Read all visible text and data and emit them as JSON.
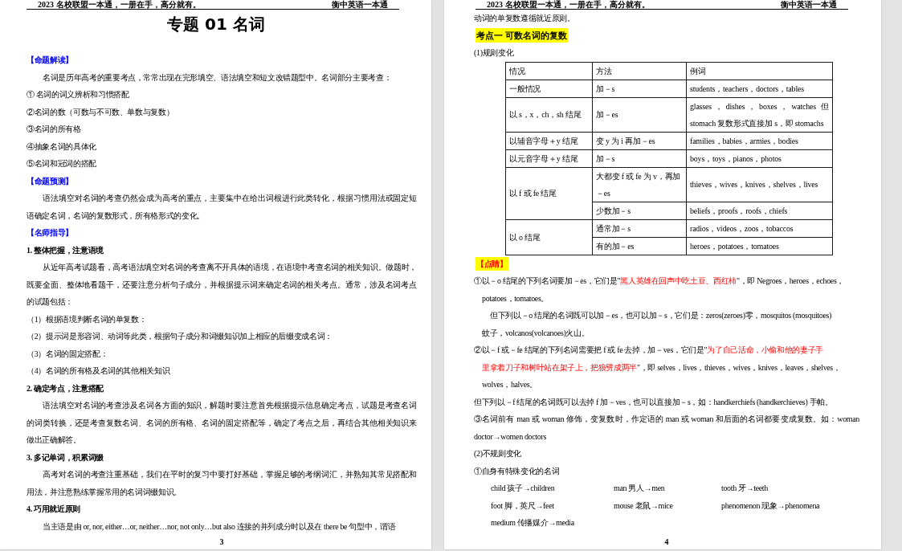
{
  "pages": [
    {
      "header": {
        "left": "2023 名校联盟一本通，一册在手，高分就有。",
        "right": "衡中英语一本通"
      },
      "blocks": [
        {
          "kind": "title",
          "lines": [
            "专题 01 名词"
          ]
        },
        {
          "kind": "section",
          "lines": [
            "【命题解读】"
          ]
        },
        {
          "kind": "paragraph",
          "lines": [
            "名词是历年高考的重要考点，常常出现在完形填空、语法填空和短文改错题型中。名词部分主要考查："
          ]
        },
        {
          "kind": "item",
          "lines": [
            "① 名词的词义辨析和习惯搭配"
          ]
        },
        {
          "kind": "item",
          "lines": [
            "②名词的数（可数与不可数、单数与复数）"
          ]
        },
        {
          "kind": "item",
          "lines": [
            "③名词的所有格"
          ]
        },
        {
          "kind": "item",
          "lines": [
            "④抽象名词的具体化"
          ]
        },
        {
          "kind": "item",
          "lines": [
            "⑤名词和冠词的搭配"
          ]
        },
        {
          "kind": "section",
          "lines": [
            "【命题预测】"
          ]
        },
        {
          "kind": "paragraph",
          "lines": [
            "语法填空对名词的考查仍然会成为高考的重点，主要集中在给出词根进行此类转化，根据习惯用法或固定短",
            "语确定名词，名词的复数形式，所有格形式的变化。"
          ]
        },
        {
          "kind": "section",
          "lines": [
            "【名师指导】"
          ]
        },
        {
          "kind": "heading",
          "lines": [
            "1. 整体把握，注意语境"
          ]
        },
        {
          "kind": "paragraph",
          "lines": [
            "从近年高考试题看，高考语法填空对名词的考查离不开具体的语境，在语境中考查名词的相关知识。做题时，",
            "既要全面、整体地看题干，还要注意分析句子成分，并根据提示词来确定名词的相关考点。通常，涉及名词考点",
            "的试题包括："
          ]
        },
        {
          "kind": "item",
          "lines": [
            "（1）根据语境判断名词的单复数："
          ]
        },
        {
          "kind": "item",
          "lines": [
            "（2）提示词是形容词、动词等此类，根据句子成分和词缀知识加上相应的后缀变成名词："
          ]
        },
        {
          "kind": "item",
          "lines": [
            "（3）名词的固定搭配："
          ]
        },
        {
          "kind": "item",
          "lines": [
            "（4）名词的所有格及名词的其他相关知识"
          ]
        },
        {
          "kind": "heading",
          "lines": [
            "2. 确定考点，注意搭配"
          ]
        },
        {
          "kind": "paragraph",
          "lines": [
            "语法填空对名词的考查涉及名词各方面的知识，解题时要注意首先根据提示信息确定考点，试题是考查名词",
            "的词类转换，还是考查复数名词、名词的所有格、名词的固定搭配等，确定了考点之后，再结合其他相关知识来",
            "做出正确解答。"
          ]
        },
        {
          "kind": "heading",
          "lines": [
            "3. 多记单词，积累词缀"
          ]
        },
        {
          "kind": "paragraph",
          "lines": [
            "高考对名词的考查注重基础，我们在平时的复习中要打好基础，掌握足够的考纲词汇，并熟知其常见搭配和",
            "用法，并注意熟练掌握常用的名词词缀知识。"
          ]
        },
        {
          "kind": "heading",
          "lines": [
            "4. 巧用就近原则"
          ]
        },
        {
          "kind": "paragraph",
          "lines": [
            "当主语是由 or, nor, either…or, neither…nor, not only…but also 连接的并列成分时以及在 there be 句型中，谓语"
          ]
        }
      ],
      "page_number": "3"
    },
    {
      "header": {
        "left": "2023 名校联盟一本通，一册在手，高分就有。",
        "right": "衡中英语一本通"
      },
      "blocks": [
        {
          "kind": "text",
          "lines": [
            "动词的单复数遵循就近原则。"
          ]
        },
        {
          "kind": "highlight",
          "lines": [
            "考点一 可数名词的复数"
          ]
        },
        {
          "kind": "text",
          "lines": [
            "(1)规则变化"
          ]
        },
        {
          "kind": "table",
          "columns": [
            "情况",
            "方法",
            "例词"
          ],
          "rows": [
            {
              "case": "一般情况",
              "forms": [
                {
                  "method": "加－s",
                  "examples": "students，teachers，doctors，tables"
                }
              ]
            },
            {
              "case": "以 s，x，ch，sh 结尾",
              "forms": [
                {
                  "method": "加－es",
                  "examples": "glasses，dishes，boxes，watches 但 stomach 复数形式直接加 s，即 stomachs"
                }
              ]
            },
            {
              "case": "以辅音字母＋y 结尾",
              "forms": [
                {
                  "method": "变 y 为 i 再加－es",
                  "examples": "families，babies，armies，bodies"
                }
              ]
            },
            {
              "case": "以元音字母＋y 结尾",
              "forms": [
                {
                  "method": "加－s",
                  "examples": "boys，toys，pianos，photos"
                }
              ]
            },
            {
              "case": "以 f 或 fe 结尾",
              "forms": [
                {
                  "method": "大都变 f 或 fe 为 v，再加－es",
                  "examples": "thieves，wives，knives，shelves，lives"
                },
                {
                  "method": "少数加－s",
                  "examples": "beliefs，proofs，roofs，chiefs"
                }
              ]
            },
            {
              "case": "以 o 结尾",
              "forms": [
                {
                  "method": "通常加－s",
                  "examples": "radios，videos，zoos，tobaccos"
                },
                {
                  "method": "有的加－es",
                  "examples": "heroes，potatoes，tomatoes"
                }
              ]
            }
          ]
        },
        {
          "kind": "tag",
          "lines": [
            "【点睛】"
          ]
        },
        {
          "kind": "hanging",
          "lines": [
            [
              {
                "text": "①以－o 结尾的下列名词要加－es，它们是\"",
                "emphasized": false
              },
              {
                "text": "黑人英雄在回声中吃土豆、西红柿",
                "emphasized": true
              },
              {
                "text": "\"，即 Negroes，heroes，echoes，",
                "emphasized": false
              }
            ],
            "potatoes，tomatoes。"
          ]
        },
        {
          "kind": "inset",
          "lines": [
            "但下列以－o 结尾的名词既可以加－es，也可以加－s，它们是：zeros(zeroes)零，mosquitos (mosquitoes)",
            "蚊子，volcanos(volcanoes)火山。"
          ]
        },
        {
          "kind": "hanging",
          "lines": [
            [
              {
                "text": "②以－f 或－fe 结尾的下列名词需要把 f 或 fe 去掉，加－ves，它们是\"",
                "emphasized": false
              },
              {
                "text": "为了自己活命，小偷和他的妻子手",
                "emphasized": true
              }
            ],
            [
              {
                "text": "里拿着刀子和树叶站在架子上，把狼劈成两半",
                "emphasized": true
              },
              {
                "text": "\"，即 selves，lives，thieves，wives，knives，leaves，shelves，",
                "emphasized": false
              }
            ],
            "wolves，halves。"
          ]
        },
        {
          "kind": "text",
          "lines": [
            "但下列以－f 结尾的名词既可以去掉 f 加－ves，也可以直接加－s，如：handkerchiefs (handkerchieves) 手帕。"
          ]
        },
        {
          "kind": "text",
          "lines": [
            "③名词前有 man 或 woman 修饰，变复数时，作定语的 man 或 woman 和后面的名词都要变成复数。如：woman",
            "doctor→women doctors"
          ]
        },
        {
          "kind": "text",
          "lines": [
            "(2)不规则变化"
          ]
        },
        {
          "kind": "item",
          "lines": [
            "①自身有特殊变化的名词"
          ]
        },
        {
          "kind": "word_grid",
          "items": [
            "child 孩子→children",
            "man 男人→men",
            "tooth 牙→teeth",
            "foot 脚，英尺→feet",
            "mouse 老鼠→mice",
            "phenomenon 现象→phenomena",
            "medium 传播媒介→media"
          ]
        }
      ],
      "page_number": "4"
    }
  ]
}
